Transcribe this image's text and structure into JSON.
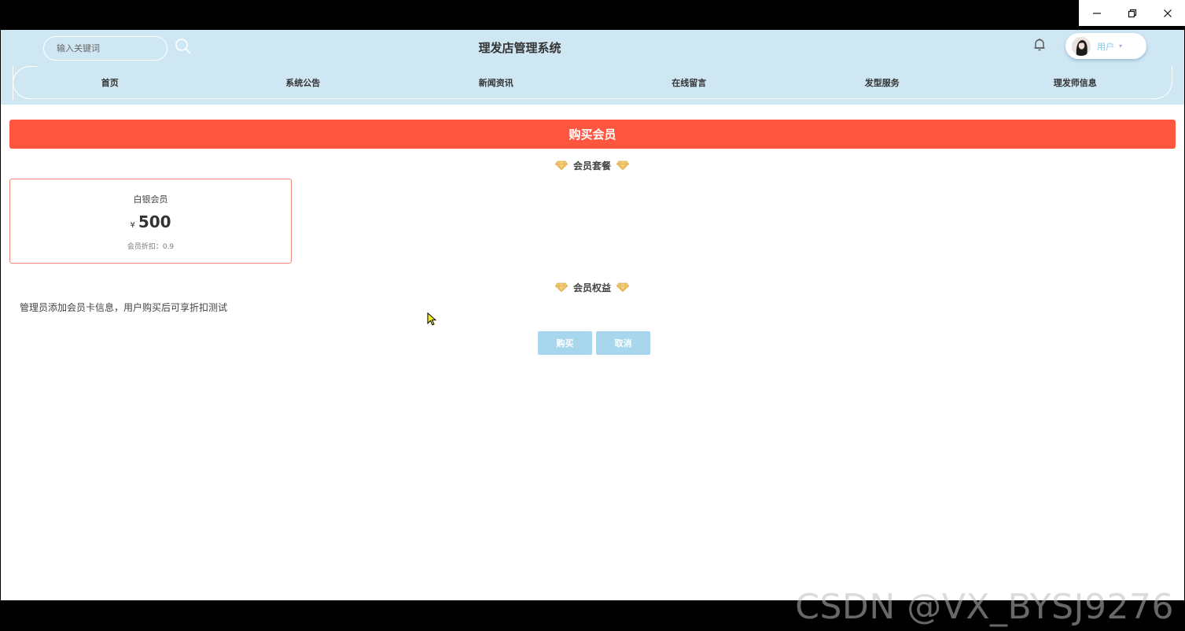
{
  "window": {
    "minimize_glyph": "–",
    "restore_glyph": "❐",
    "close_glyph": "✕"
  },
  "header": {
    "search": {
      "placeholder": "输入关键词",
      "value": ""
    },
    "title": "理发店管理系统",
    "user": {
      "name": "用户",
      "caret": "▾"
    }
  },
  "nav": {
    "items": [
      {
        "label": "首页"
      },
      {
        "label": "系统公告"
      },
      {
        "label": "新闻资讯"
      },
      {
        "label": "在线留言"
      },
      {
        "label": "发型服务"
      },
      {
        "label": "理发师信息"
      }
    ]
  },
  "page": {
    "banner": "购买会员",
    "packages_title": "会员套餐",
    "benefits_title": "会员权益",
    "plan": {
      "name": "白银会员",
      "currency": "¥",
      "price": "500",
      "discount": "会员折扣：0.9"
    },
    "benefits_text": "管理员添加会员卡信息，用户购买后可享折扣测试",
    "buy_label": "购买",
    "cancel_label": "取消"
  },
  "watermark": "CSDN @VX_BYSJ9276",
  "colors": {
    "header_bg": "#cfe6f3",
    "banner": "#ff573f",
    "button": "#a8d6ec",
    "card_border": "#f0867a",
    "gem": "#f3c462"
  }
}
